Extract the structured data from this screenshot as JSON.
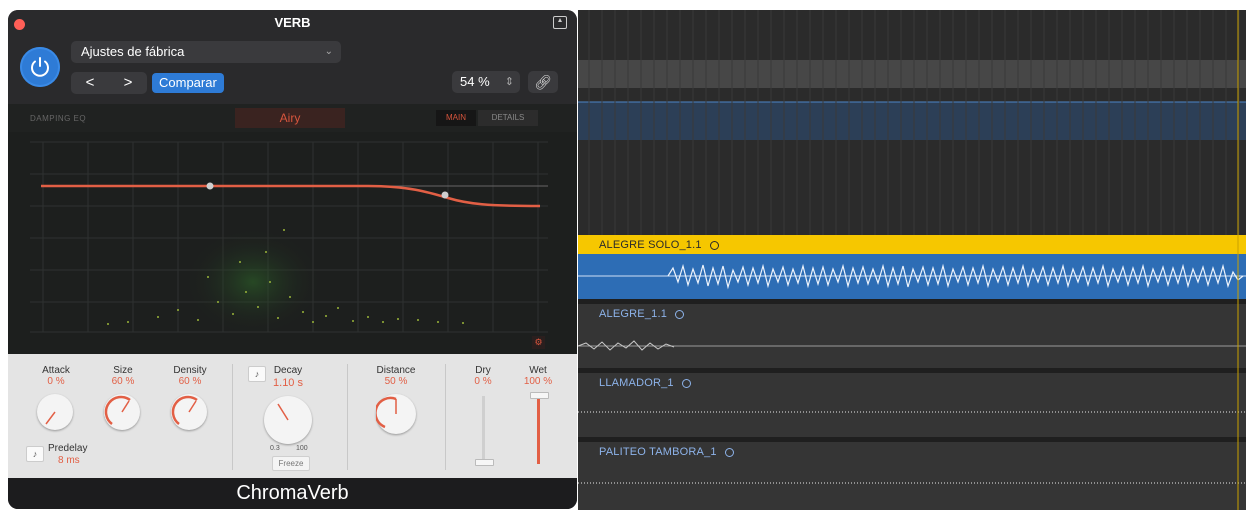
{
  "window": {
    "title": "VERB"
  },
  "header": {
    "preset": "Ajustes de fábrica",
    "prev_label": "<",
    "next_label": ">",
    "compare_label": "Comparar",
    "mix_value": "54 %"
  },
  "graph": {
    "damping_label": "DAMPING EQ",
    "room_type": "Airy",
    "tab_main": "MAIN",
    "tab_details": "DETAILS"
  },
  "controls": {
    "attack": {
      "label": "Attack",
      "value": "0 %"
    },
    "size": {
      "label": "Size",
      "value": "60 %"
    },
    "density": {
      "label": "Density",
      "value": "60 %"
    },
    "predelay": {
      "label": "Predelay",
      "value": "8 ms"
    },
    "decay": {
      "label": "Decay",
      "value": "1.10 s",
      "range_min": "0.3",
      "range_max": "100",
      "freeze_label": "Freeze"
    },
    "distance": {
      "label": "Distance",
      "value": "50 %"
    },
    "dry": {
      "label": "Dry",
      "value": "0 %"
    },
    "wet": {
      "label": "Wet",
      "value": "100 %"
    }
  },
  "footer": {
    "plugin_name": "ChromaVerb"
  },
  "tracks": [
    {
      "name": "ALEGRE SOLO_1.1"
    },
    {
      "name": "ALEGRE_1.1"
    },
    {
      "name": "LLAMADOR_1"
    },
    {
      "name": "PALITEO TAMBORA_1"
    }
  ],
  "colors": {
    "accent": "#2e7bd6",
    "curve": "#e25f45",
    "region_yellow": "#f6c700",
    "region_blue": "#2d6db5"
  }
}
